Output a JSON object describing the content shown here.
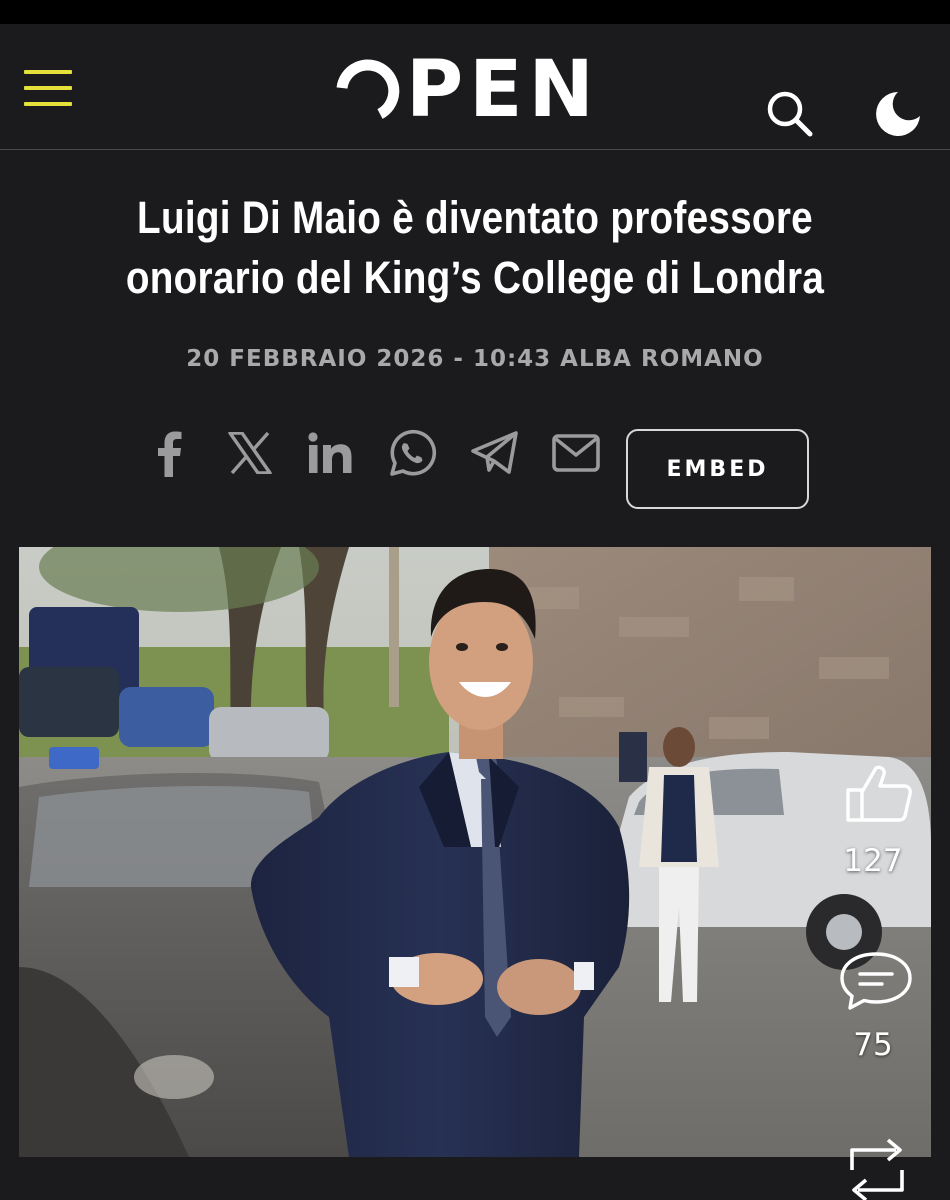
{
  "header": {
    "logo_text": "PEN",
    "accent_color": "#e6e13a",
    "menu_icon": "hamburger-menu-icon",
    "search_icon": "search-icon",
    "theme_icon": "moon-icon"
  },
  "article": {
    "title": "Luigi Di Maio è diventato professore onorario del King’s College di Londra",
    "meta": "20 FEBBRAIO 2026 - 10:43 ALBA ROMANO"
  },
  "share": {
    "icons": [
      "facebook-icon",
      "x-icon",
      "linkedin-icon",
      "whatsapp-icon",
      "telegram-icon",
      "email-icon"
    ],
    "embed_label": "EMBED"
  },
  "reactions": {
    "likes": "127",
    "comments": "75"
  }
}
